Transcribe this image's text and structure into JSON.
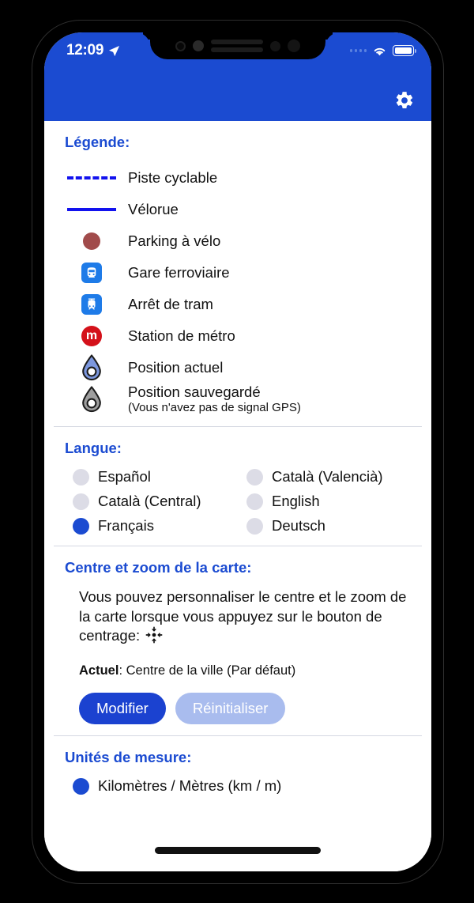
{
  "statusbar": {
    "time": "12:09",
    "location_icon": "location-arrow-icon",
    "signal_icon": "signal-dots-icon",
    "wifi_icon": "wifi-icon",
    "battery_icon": "battery-full-icon"
  },
  "header": {
    "settings_icon": "gear-icon",
    "background_color": "#1B4BD1"
  },
  "legend": {
    "title": "Légende:",
    "items": [
      {
        "icon": "dashed-line-icon",
        "label": "Piste cyclable",
        "sub": "",
        "color": "#1212EE"
      },
      {
        "icon": "solid-line-icon",
        "label": "Vélorue",
        "sub": "",
        "color": "#1212EE"
      },
      {
        "icon": "bike-parking-dot-icon",
        "label": "Parking à vélo",
        "sub": "",
        "color": "#A14B4B"
      },
      {
        "icon": "train-station-icon",
        "label": "Gare ferroviaire",
        "sub": "",
        "color": "#1E7BE8"
      },
      {
        "icon": "tram-stop-icon",
        "label": "Arrêt de tram",
        "sub": "",
        "color": "#1E7BE8"
      },
      {
        "icon": "metro-station-icon",
        "label": "Station de métro",
        "sub": "",
        "color": "#D4111A"
      },
      {
        "icon": "current-position-icon",
        "label": "Position actuel",
        "sub": "",
        "color": "#7C97DE"
      },
      {
        "icon": "saved-position-icon",
        "label": "Position sauvegardé",
        "sub": "(Vous n'avez pas de signal GPS)",
        "color": "#9E9E9E"
      }
    ],
    "metro_letter": "m"
  },
  "language": {
    "title": "Langue:",
    "options": [
      {
        "label": "Español",
        "selected": false
      },
      {
        "label": "Català (Valencià)",
        "selected": false
      },
      {
        "label": "Català (Central)",
        "selected": false
      },
      {
        "label": "English",
        "selected": false
      },
      {
        "label": "Français",
        "selected": true
      },
      {
        "label": "Deutsch",
        "selected": false
      }
    ]
  },
  "map_center": {
    "title": "Centre et zoom de la carte:",
    "description": "Vous pouvez personnaliser le centre et le zoom de la carte lorsque vous appuyez sur le bouton de centrage:",
    "center_icon": "crosshair-center-icon",
    "current_label": "Actuel",
    "current_value": ": Centre de la ville (Par défaut)",
    "edit_button": "Modifier",
    "reset_button": "Réinitialiser",
    "edit_color": "#1B42D0",
    "reset_color": "#A9BCEE"
  },
  "units": {
    "title": "Unités de mesure:",
    "options": [
      {
        "label": "Kilomètres / Mètres (km / m)",
        "selected": true
      }
    ]
  }
}
